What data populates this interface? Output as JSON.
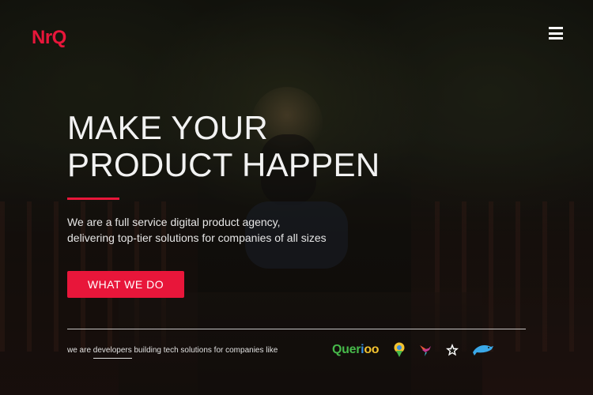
{
  "header": {
    "logo_text": "NrQ",
    "menu_icon": "hamburger-menu-icon"
  },
  "hero": {
    "headline_line1": "MAKE YOUR",
    "headline_line2": "PRODUCT HAPPEN",
    "subtitle_line1": "We are a full service digital product agency,",
    "subtitle_line2": "delivering top-tier solutions for companies of all sizes",
    "cta_label": "WHAT WE DO"
  },
  "footer": {
    "tagline_prefix": "we are ",
    "tagline_link": "developers",
    "tagline_suffix": " building tech solutions for companies like",
    "clients": {
      "querioo_part1": "Q",
      "querioo_part2": "uer",
      "querioo_part3": "i",
      "querioo_part4": "oo",
      "icons": [
        "map-pin-bubble-icon",
        "hummingbird-icon",
        "star-icon",
        "dolphin-icon"
      ]
    }
  },
  "colors": {
    "accent": "#e8163a",
    "text": "#ffffff"
  }
}
